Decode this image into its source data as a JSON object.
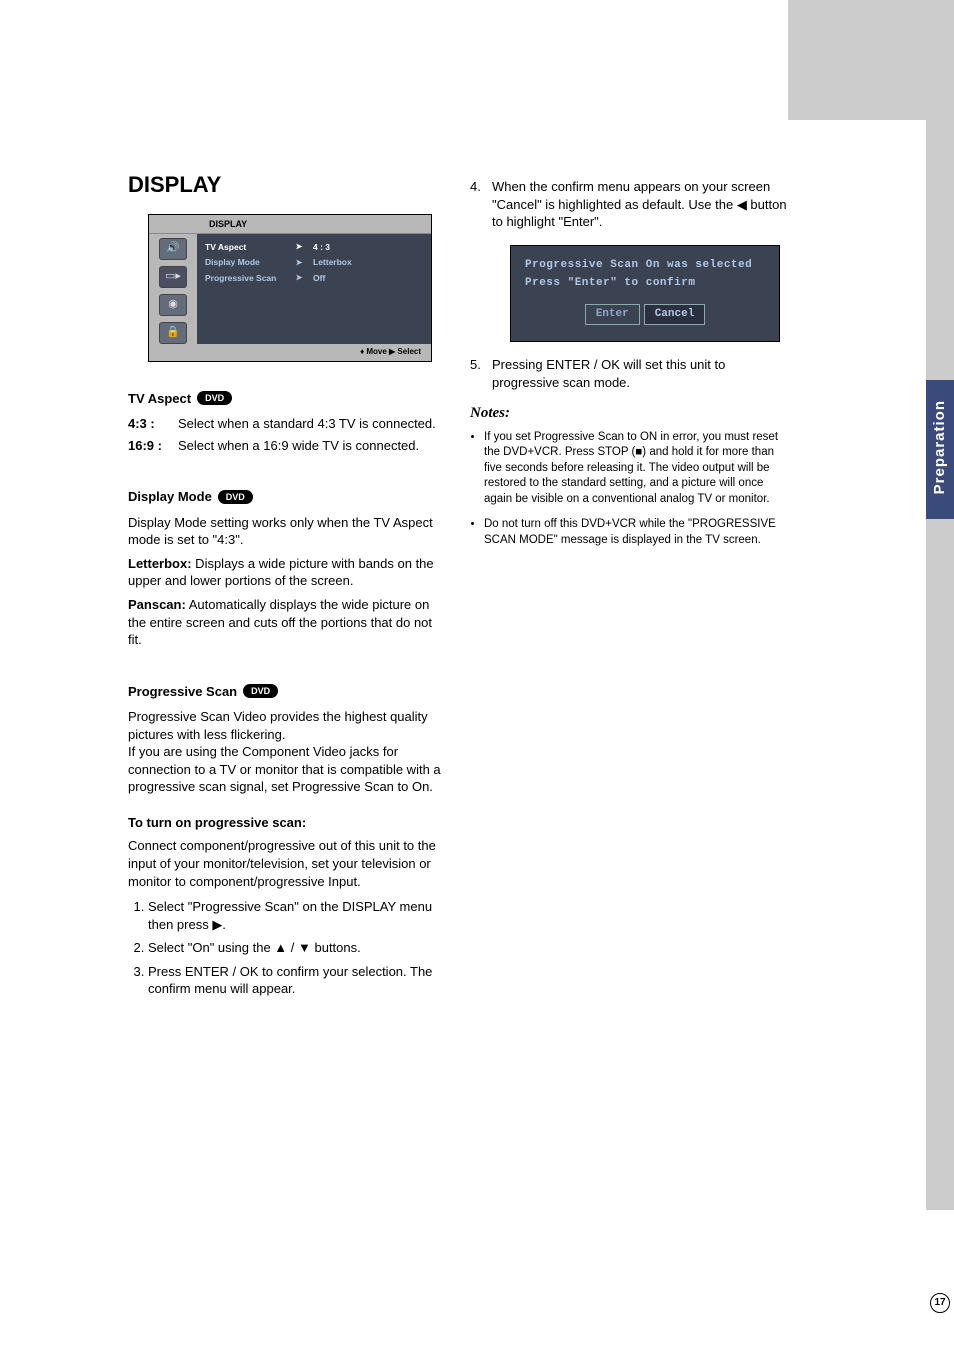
{
  "header_gray": true,
  "section_title": "DISPLAY",
  "osd": {
    "title": "DISPLAY",
    "rows": [
      {
        "label": "TV Aspect",
        "arrow": "➤",
        "value": "4  :  3",
        "selected": true
      },
      {
        "label": "Display Mode",
        "arrow": "➤",
        "value": "Letterbox",
        "selected": false
      },
      {
        "label": "Progressive Scan",
        "arrow": "➤",
        "value": "Off",
        "selected": false
      }
    ],
    "footer": "♦ Move     ▶  Select",
    "icons": [
      "speaker-icon",
      "display-icon",
      "disc-icon",
      "lock-icon"
    ]
  },
  "tv_aspect": {
    "heading": "TV Aspect",
    "badge": "DVD",
    "items": [
      {
        "k": "4:3 :",
        "v": "Select when a standard 4:3 TV is connected."
      },
      {
        "k": "16:9 :",
        "v": "Select when a 16:9 wide TV is connected."
      }
    ]
  },
  "display_mode": {
    "heading": "Display Mode",
    "badge": "DVD",
    "p1": "Display Mode setting works only when the TV Aspect mode is set to \"4:3\".",
    "lb_label": "Letterbox:",
    "lb_text": " Displays a wide picture with bands on the upper and lower portions of the screen.",
    "ps_label": "Panscan:",
    "ps_text": " Automatically displays the wide picture on the entire screen and cuts off the portions that do not fit."
  },
  "progressive": {
    "heading": "Progressive Scan",
    "badge": "DVD",
    "para": "Progressive Scan Video provides the highest quality pictures with less flickering.\nIf you are using the Component Video jacks for connection to a TV or monitor that is compatible with a progressive scan signal, set Progressive Scan to On.",
    "sub": "To turn on progressive scan:",
    "connect": "Connect component/progressive out of this unit to the input of your monitor/television, set your television or monitor to component/progressive Input.",
    "steps": [
      "Select \"Progressive Scan\" on the DISPLAY menu then press ▶.",
      "Select \"On\" using the ▲ / ▼ buttons.",
      "Press ENTER / OK to confirm your selection. The confirm menu will appear."
    ]
  },
  "right": {
    "step4": "When the confirm menu appears on your screen \"Cancel\" is highlighted as default. Use the ◀ button to highlight \"Enter\".",
    "step5": "Pressing ENTER / OK will set this unit to progressive scan mode.",
    "confirm": {
      "line1": "Progressive Scan On was selected",
      "line2": "Press \"Enter\" to confirm",
      "enter": "Enter",
      "cancel": "Cancel"
    },
    "notes_h": "Notes:",
    "notes": [
      "If you set Progressive Scan to ON in error, you must reset the DVD+VCR. Press STOP (■) and hold it for more than five seconds before releasing it. The video output will be restored to the standard setting, and a picture will once again be visible on a conventional analog TV or monitor.",
      "Do not turn off this DVD+VCR while the \"PROGRESSIVE SCAN MODE\" message is displayed in the TV screen."
    ]
  },
  "side_tab": "Preparation",
  "page_number": "17"
}
